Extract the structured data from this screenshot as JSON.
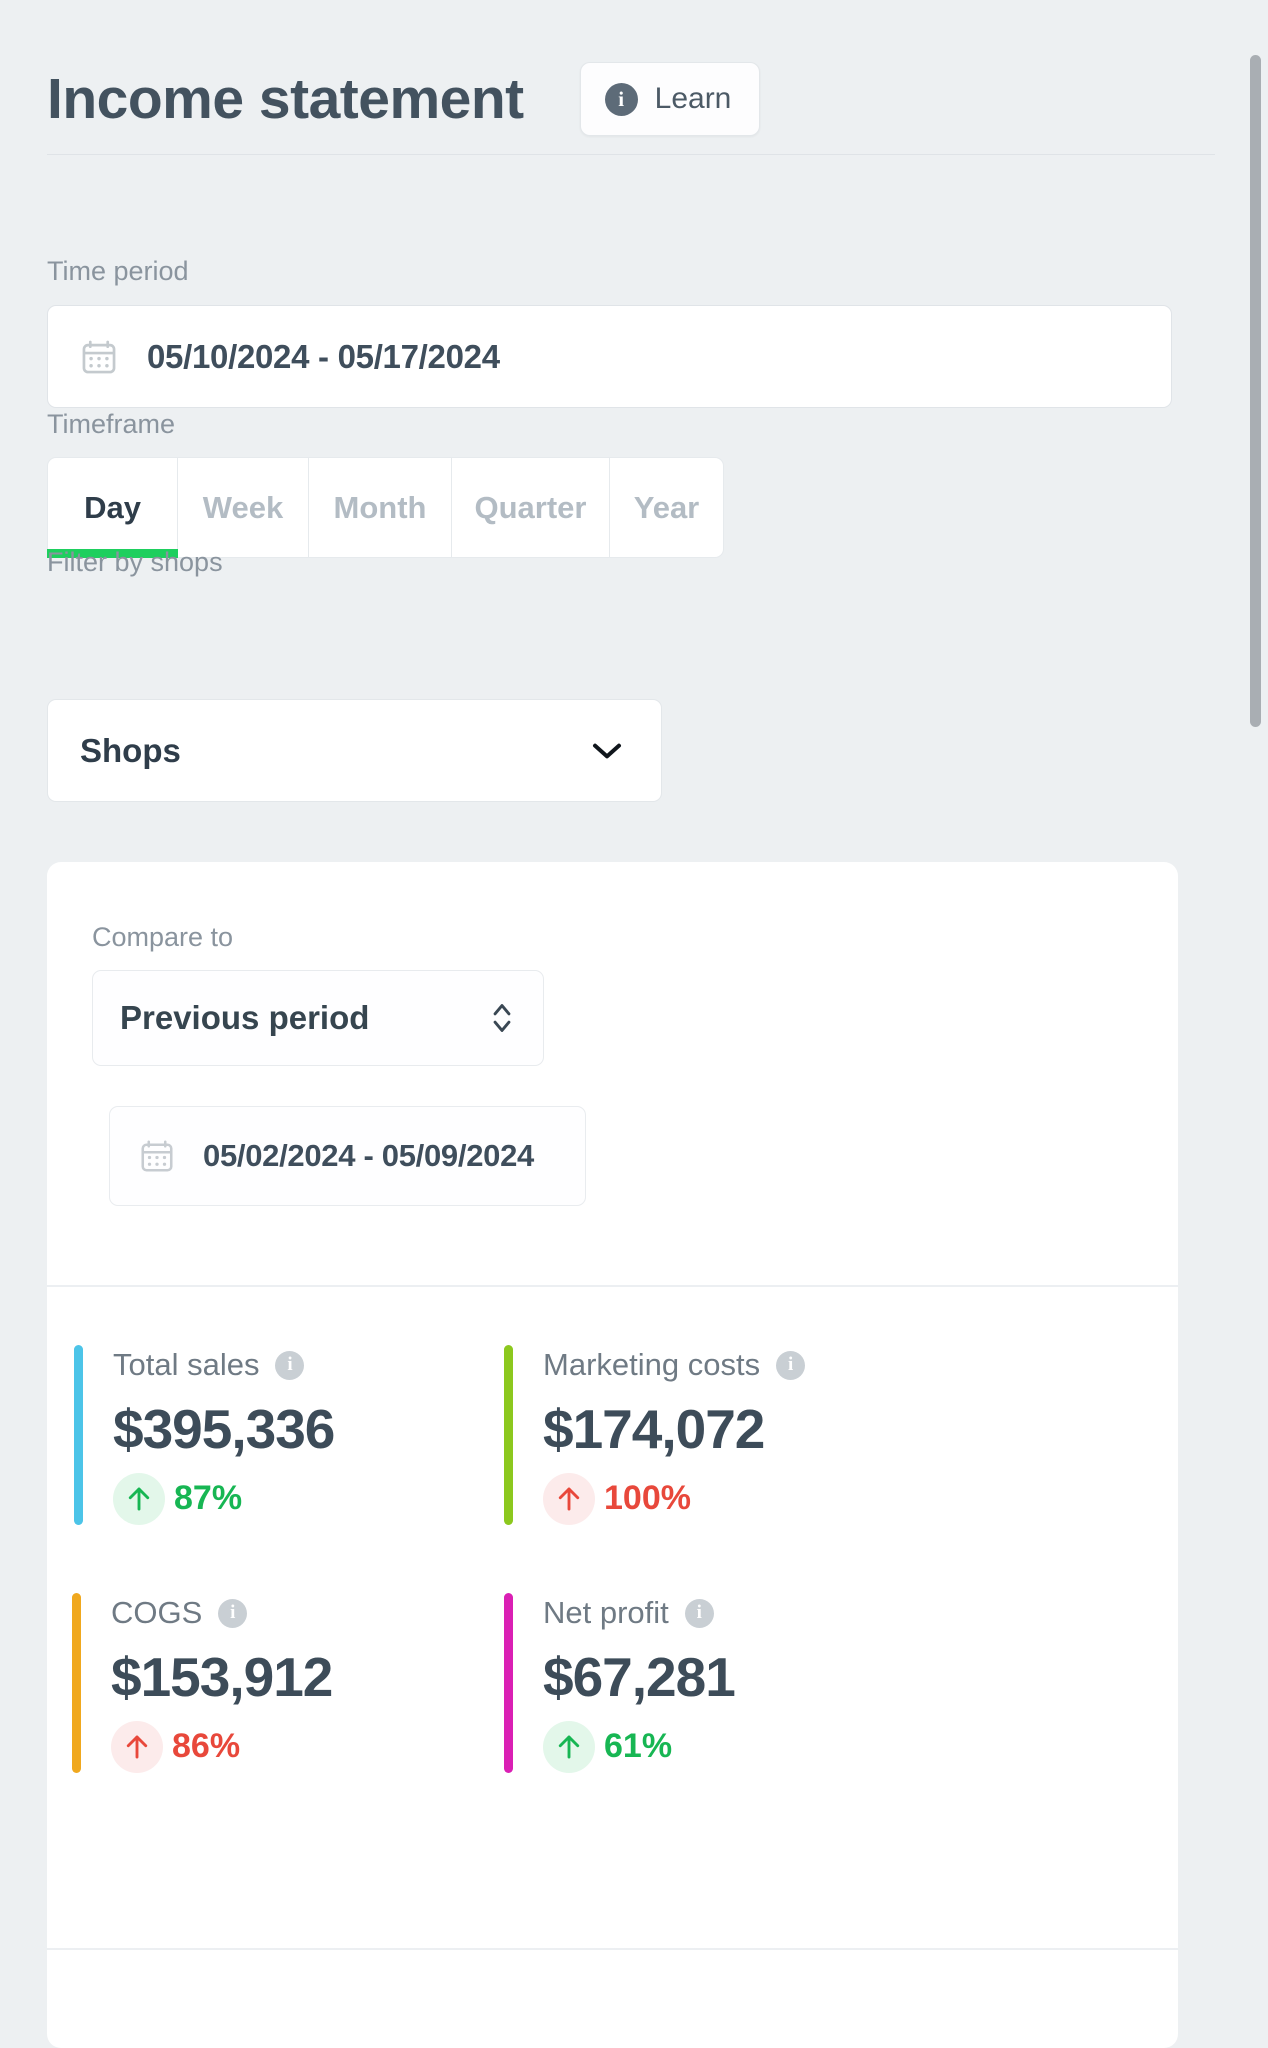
{
  "header": {
    "title": "Income statement",
    "learn_label": "Learn",
    "info_glyph": "i"
  },
  "filters": {
    "time_period_label": "Time period",
    "time_period_value": "05/10/2024 - 05/17/2024",
    "timeframe_label": "Timeframe",
    "timeframe_tabs": [
      {
        "label": "Day",
        "active": true
      },
      {
        "label": "Week",
        "active": false
      },
      {
        "label": "Month",
        "active": false
      },
      {
        "label": "Quarter",
        "active": false
      },
      {
        "label": "Year",
        "active": false
      }
    ],
    "shops_label": "Filter by shops",
    "shops_value": "Shops"
  },
  "panel": {
    "compare_label": "Compare to",
    "compare_value": "Previous period",
    "compare_date_value": "05/02/2024 - 05/09/2024"
  },
  "metrics": [
    {
      "title": "Total sales",
      "value": "$395,336",
      "delta": "87%",
      "direction": "up",
      "delta_tone": "green",
      "accent": "#4cc4e8"
    },
    {
      "title": "Marketing costs",
      "value": "$174,072",
      "delta": "100%",
      "direction": "up",
      "delta_tone": "red",
      "accent": "#8cc81e"
    },
    {
      "title": "COGS",
      "value": "$153,912",
      "delta": "86%",
      "direction": "up",
      "delta_tone": "red",
      "accent": "#f0a81e"
    },
    {
      "title": "Net profit",
      "value": "$67,281",
      "delta": "61%",
      "direction": "up",
      "delta_tone": "green",
      "accent": "#da1fb4"
    }
  ],
  "colors": {
    "page_bg": "#edf0f2",
    "panel_bg": "#ffffff",
    "title_text": "#43525f",
    "muted_text": "#8a949e",
    "active_tab_underline": "#1ecf5e",
    "positive": "#17b653",
    "negative": "#e8483b"
  },
  "icons": {
    "calendar": "calendar-icon",
    "chevron_down": "chevron-down-icon",
    "chevron_updown": "chevron-up-down-icon",
    "arrow_up": "arrow-up-icon",
    "info": "info-icon"
  }
}
